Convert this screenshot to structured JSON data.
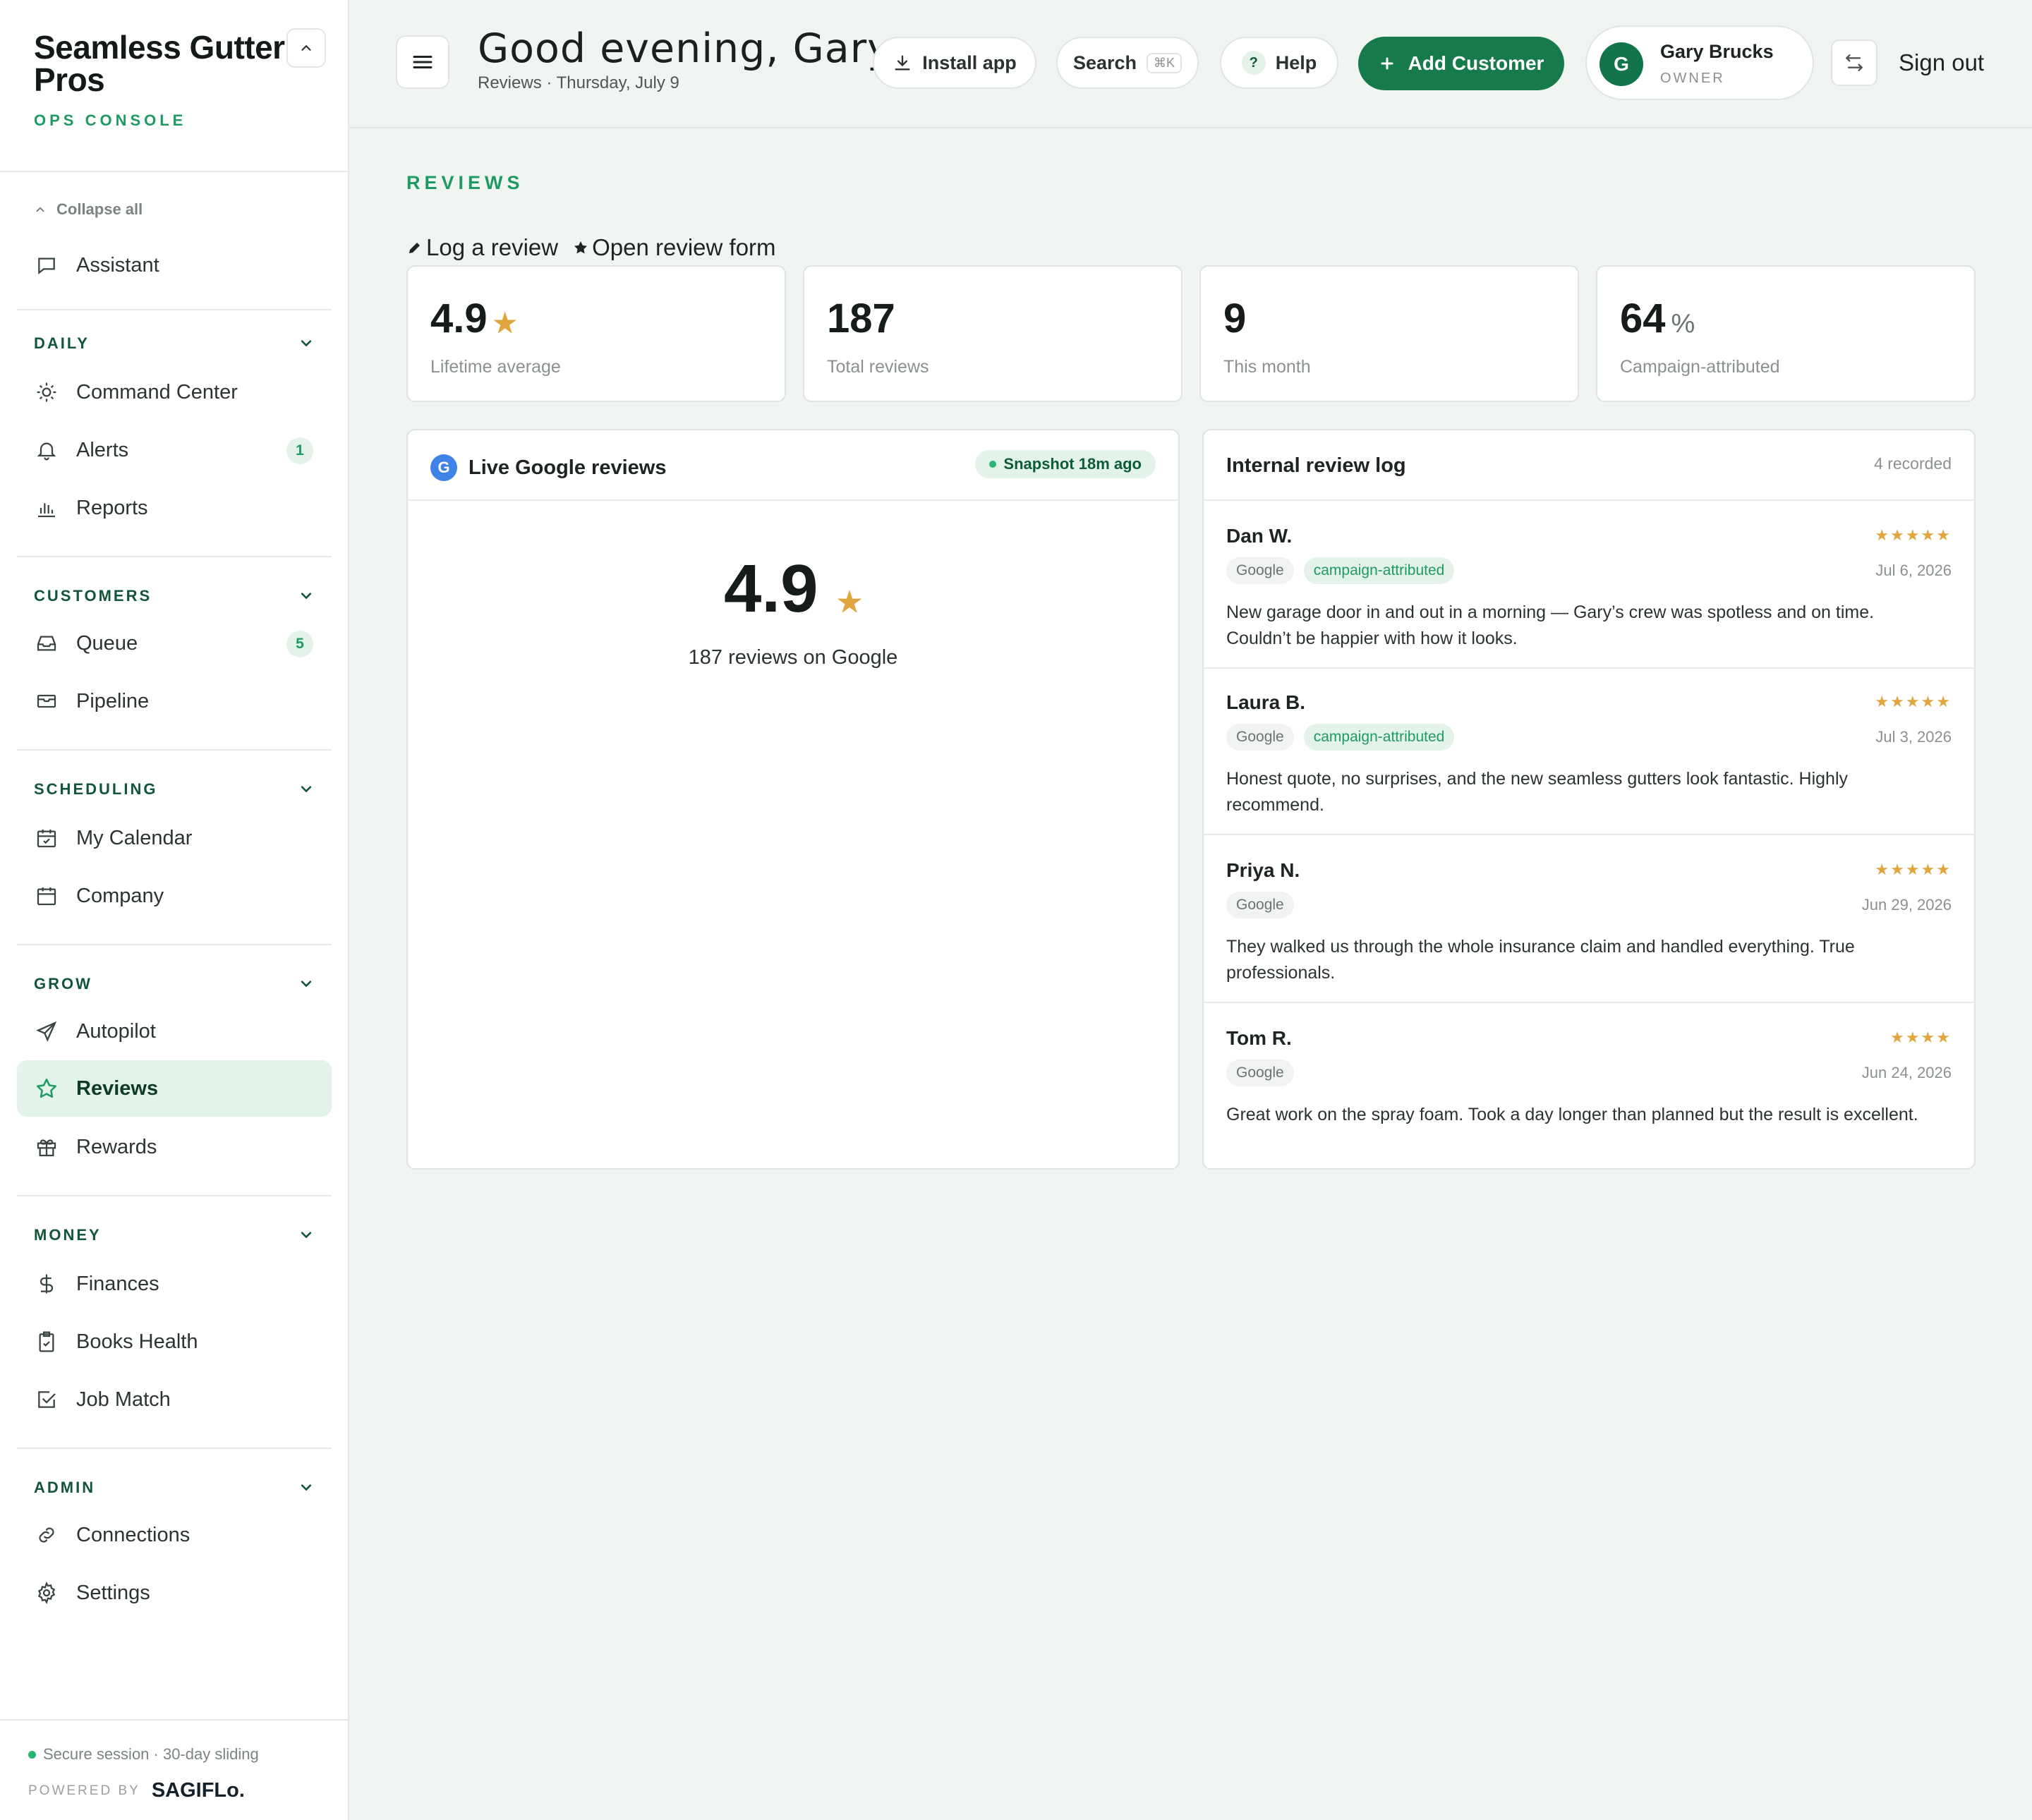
{
  "brand": {
    "name": "Seamless Gutter Pros",
    "subtitle": "OPS CONSOLE"
  },
  "sidebar": {
    "collapse_all": "Collapse all",
    "assistant": "Assistant",
    "sections": [
      {
        "label": "DAILY",
        "items": [
          {
            "label": "Command Center",
            "icon": "sun-icon"
          },
          {
            "label": "Alerts",
            "icon": "bell-icon",
            "badge": "1"
          },
          {
            "label": "Reports",
            "icon": "bar-chart-icon"
          }
        ]
      },
      {
        "label": "CUSTOMERS",
        "items": [
          {
            "label": "Queue",
            "icon": "inbox-icon",
            "badge": "5"
          },
          {
            "label": "Pipeline",
            "icon": "envelope-icon"
          }
        ]
      },
      {
        "label": "SCHEDULING",
        "items": [
          {
            "label": "My Calendar",
            "icon": "calendar-check-icon"
          },
          {
            "label": "Company",
            "icon": "calendar-icon"
          }
        ]
      },
      {
        "label": "GROW",
        "items": [
          {
            "label": "Autopilot",
            "icon": "send-icon"
          },
          {
            "label": "Reviews",
            "icon": "star-icon",
            "active": true
          },
          {
            "label": "Rewards",
            "icon": "gift-icon"
          }
        ]
      },
      {
        "label": "MONEY",
        "items": [
          {
            "label": "Finances",
            "icon": "dollar-icon"
          },
          {
            "label": "Books Health",
            "icon": "clipboard-check-icon"
          },
          {
            "label": "Job Match",
            "icon": "checkbox-icon"
          }
        ]
      },
      {
        "label": "ADMIN",
        "items": [
          {
            "label": "Connections",
            "icon": "link-icon"
          },
          {
            "label": "Settings",
            "icon": "gear-icon"
          }
        ]
      }
    ],
    "footer": {
      "secure": "Secure session · 30-day sliding",
      "powered_by": "POWERED BY",
      "logo": "SAGIFLo."
    }
  },
  "header": {
    "greeting": "Good evening, Gary",
    "subtitle": "Reviews · Thursday, July 9",
    "install_app": "Install app",
    "search": "Search",
    "search_shortcut": "⌘K",
    "help": "Help",
    "add_customer": "Add Customer",
    "user": {
      "initial": "G",
      "name": "Gary Brucks",
      "role": "OWNER"
    },
    "sign_out": "Sign out"
  },
  "main": {
    "title": "REVIEWS",
    "actions": {
      "log_review": "Log a review",
      "open_form": "Open review form"
    },
    "stats": [
      {
        "value": "4.9",
        "suffix": "★",
        "label": "Lifetime average"
      },
      {
        "value": "187",
        "suffix": "",
        "label": "Total reviews"
      },
      {
        "value": "9",
        "suffix": "",
        "label": "This month"
      },
      {
        "value": "64",
        "suffix": "%",
        "label": "Campaign-attributed"
      }
    ],
    "google_panel": {
      "title": "Live Google reviews",
      "icon_letter": "G",
      "snapshot": "Snapshot 18m ago",
      "rating": "4.9",
      "caption": "187 reviews on Google"
    },
    "log_panel": {
      "title": "Internal review log",
      "count": "4 recorded",
      "reviews": [
        {
          "name": "Dan W.",
          "stars": "★★★★★",
          "tags": [
            "Google",
            "campaign-attributed"
          ],
          "date": "Jul 6, 2026",
          "text": "New garage door in and out in a morning — Gary’s crew was spotless and on time. Couldn’t be happier with how it looks."
        },
        {
          "name": "Laura B.",
          "stars": "★★★★★",
          "tags": [
            "Google",
            "campaign-attributed"
          ],
          "date": "Jul 3, 2026",
          "text": "Honest quote, no surprises, and the new seamless gutters look fantastic. Highly recommend."
        },
        {
          "name": "Priya N.",
          "stars": "★★★★★",
          "tags": [
            "Google"
          ],
          "date": "Jun 29, 2026",
          "text": "They walked us through the whole insurance claim and handled everything. True professionals."
        },
        {
          "name": "Tom R.",
          "stars": "★★★★",
          "tags": [
            "Google"
          ],
          "date": "Jun 24, 2026",
          "text": "Great work on the spray foam. Took a day longer than planned but the result is excellent."
        }
      ]
    }
  },
  "colors": {
    "accent": "#167a4b",
    "accent_light": "#e3f3ea",
    "star": "#e0a53f",
    "background": "#f1f5f2"
  }
}
